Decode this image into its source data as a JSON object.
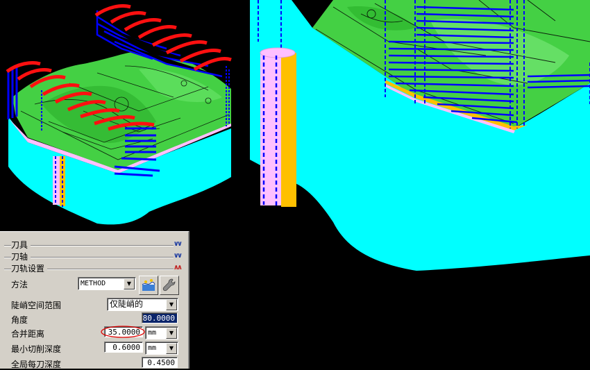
{
  "colors": {
    "stock_cyan": "#00ffff",
    "part_green": "#4fd84f",
    "path_blue": "#0000ff",
    "path_red": "#ff1010",
    "tool_orange": "#ffc000",
    "tool_pink": "#ffc0ff",
    "background": "#000000"
  },
  "panel": {
    "groups": [
      {
        "title": "刀具",
        "state": "collapsed",
        "icon": "double-chevron-down-icon"
      },
      {
        "title": "刀轴",
        "state": "collapsed",
        "icon": "double-chevron-down-icon"
      },
      {
        "title": "刀轨设置",
        "state": "expanded",
        "icon": "double-chevron-up-icon"
      }
    ],
    "method": {
      "label": "方法",
      "value": "METHOD",
      "icon1": "method-edit-icon",
      "icon2": "wrench-icon"
    },
    "steep": {
      "label": "陡峭空间范围",
      "value": "仅陡峭的"
    },
    "angle": {
      "label": "角度",
      "value": "80.0000"
    },
    "merge": {
      "label": "合并距离",
      "value": "35.0000",
      "unit": "mm"
    },
    "min_depth": {
      "label": "最小切削深度",
      "value": "0.6000",
      "unit": "mm"
    },
    "global_depth": {
      "label": "全局每刀深度",
      "value": "0.4500"
    }
  }
}
